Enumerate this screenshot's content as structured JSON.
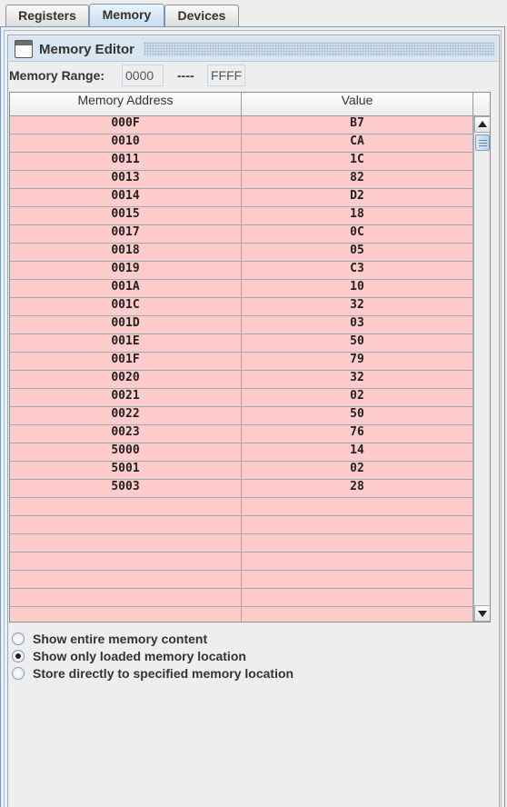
{
  "tabs": [
    {
      "label": "Registers",
      "active": false
    },
    {
      "label": "Memory",
      "active": true
    },
    {
      "label": "Devices",
      "active": false
    }
  ],
  "memory_editor": {
    "title": "Memory Editor",
    "range_label": "Memory Range:",
    "range_start": "0000",
    "range_separator": "----",
    "range_end": "FFFF",
    "table": {
      "columns": [
        "Memory Address",
        "Value"
      ],
      "rows": [
        [
          "000F",
          "B7"
        ],
        [
          "0010",
          "CA"
        ],
        [
          "0011",
          "1C"
        ],
        [
          "0013",
          "82"
        ],
        [
          "0014",
          "D2"
        ],
        [
          "0015",
          "18"
        ],
        [
          "0017",
          "0C"
        ],
        [
          "0018",
          "05"
        ],
        [
          "0019",
          "C3"
        ],
        [
          "001A",
          "10"
        ],
        [
          "001C",
          "32"
        ],
        [
          "001D",
          "03"
        ],
        [
          "001E",
          "50"
        ],
        [
          "001F",
          "79"
        ],
        [
          "0020",
          "32"
        ],
        [
          "0021",
          "02"
        ],
        [
          "0022",
          "50"
        ],
        [
          "0023",
          "76"
        ],
        [
          "5000",
          "14"
        ],
        [
          "5001",
          "02"
        ],
        [
          "5003",
          "28"
        ],
        [
          "",
          ""
        ],
        [
          "",
          ""
        ],
        [
          "",
          ""
        ],
        [
          "",
          ""
        ],
        [
          "",
          ""
        ],
        [
          "",
          ""
        ],
        [
          "",
          ""
        ]
      ],
      "row_color": "#ffcccc"
    },
    "options": [
      {
        "label": "Show entire memory content",
        "selected": false
      },
      {
        "label": "Show only loaded memory location",
        "selected": true
      },
      {
        "label": "Store directly to specified memory location",
        "selected": false
      }
    ]
  },
  "icons": {
    "window": "window-icon",
    "scroll_up": "arrow-up-icon",
    "scroll_down": "arrow-down-icon"
  }
}
